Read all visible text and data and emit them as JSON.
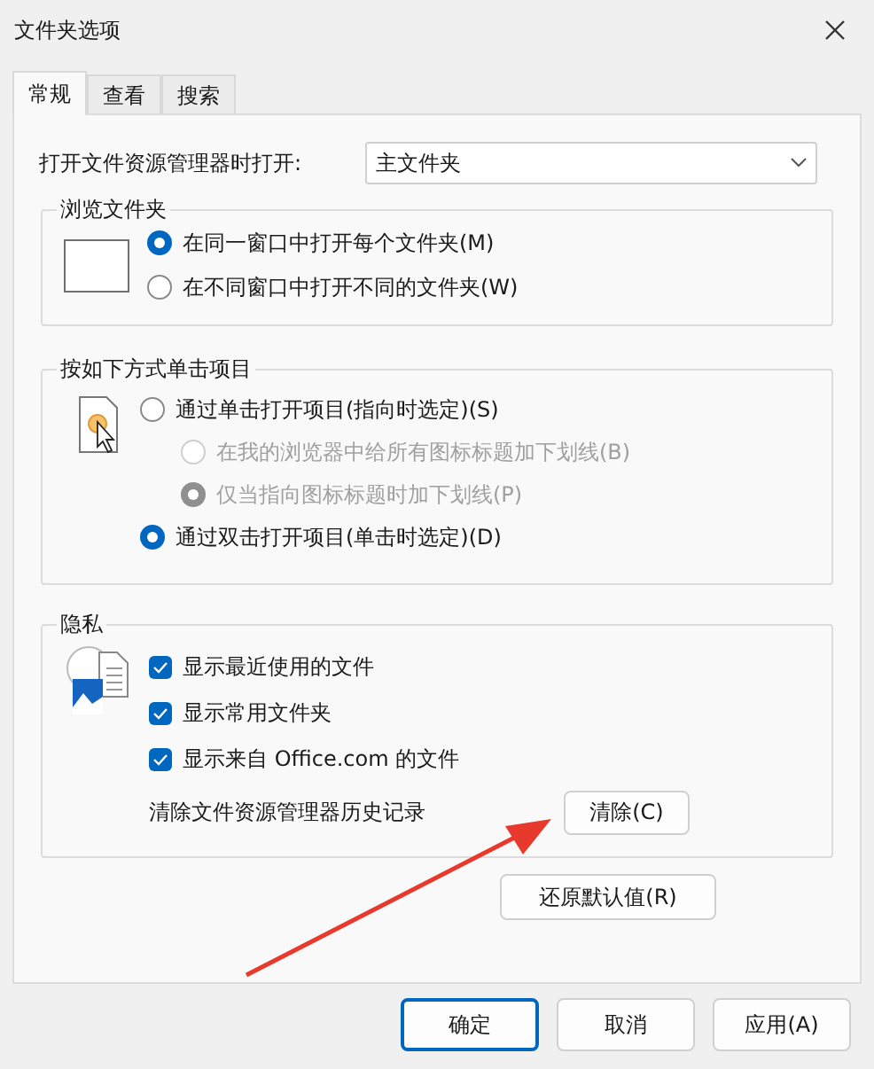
{
  "window": {
    "title": "文件夹选项"
  },
  "tabs": [
    {
      "label": "常规",
      "selected": true
    },
    {
      "label": "查看",
      "selected": false
    },
    {
      "label": "搜索",
      "selected": false
    }
  ],
  "open_explorer": {
    "label": "打开文件资源管理器时打开:",
    "value": "主文件夹"
  },
  "browse": {
    "title": "浏览文件夹",
    "options": [
      {
        "label": "在同一窗口中打开每个文件夹(M)",
        "selected": true
      },
      {
        "label": "在不同窗口中打开不同的文件夹(W)",
        "selected": false
      }
    ]
  },
  "click": {
    "title": "按如下方式单击项目",
    "options": [
      {
        "label": "通过单击打开项目(指向时选定)(S)",
        "selected": false,
        "children": [
          {
            "label": "在我的浏览器中给所有图标标题加下划线(B)",
            "selected": false,
            "disabled": true
          },
          {
            "label": "仅当指向图标标题时加下划线(P)",
            "selected": true,
            "disabled": true
          }
        ]
      },
      {
        "label": "通过双击打开项目(单击时选定)(D)",
        "selected": true
      }
    ]
  },
  "privacy": {
    "title": "隐私",
    "checks": [
      {
        "label": "显示最近使用的文件",
        "checked": true
      },
      {
        "label": "显示常用文件夹",
        "checked": true
      },
      {
        "label": "显示来自 Office.com 的文件",
        "checked": true
      }
    ],
    "clear_label": "清除文件资源管理器历史记录",
    "clear_button": "清除(C)"
  },
  "restore_button": "还原默认值(R)",
  "buttons": [
    {
      "label": "确定",
      "kind": "primary"
    },
    {
      "label": "取消",
      "kind": "normal"
    },
    {
      "label": "应用(A)",
      "kind": "normal"
    }
  ]
}
